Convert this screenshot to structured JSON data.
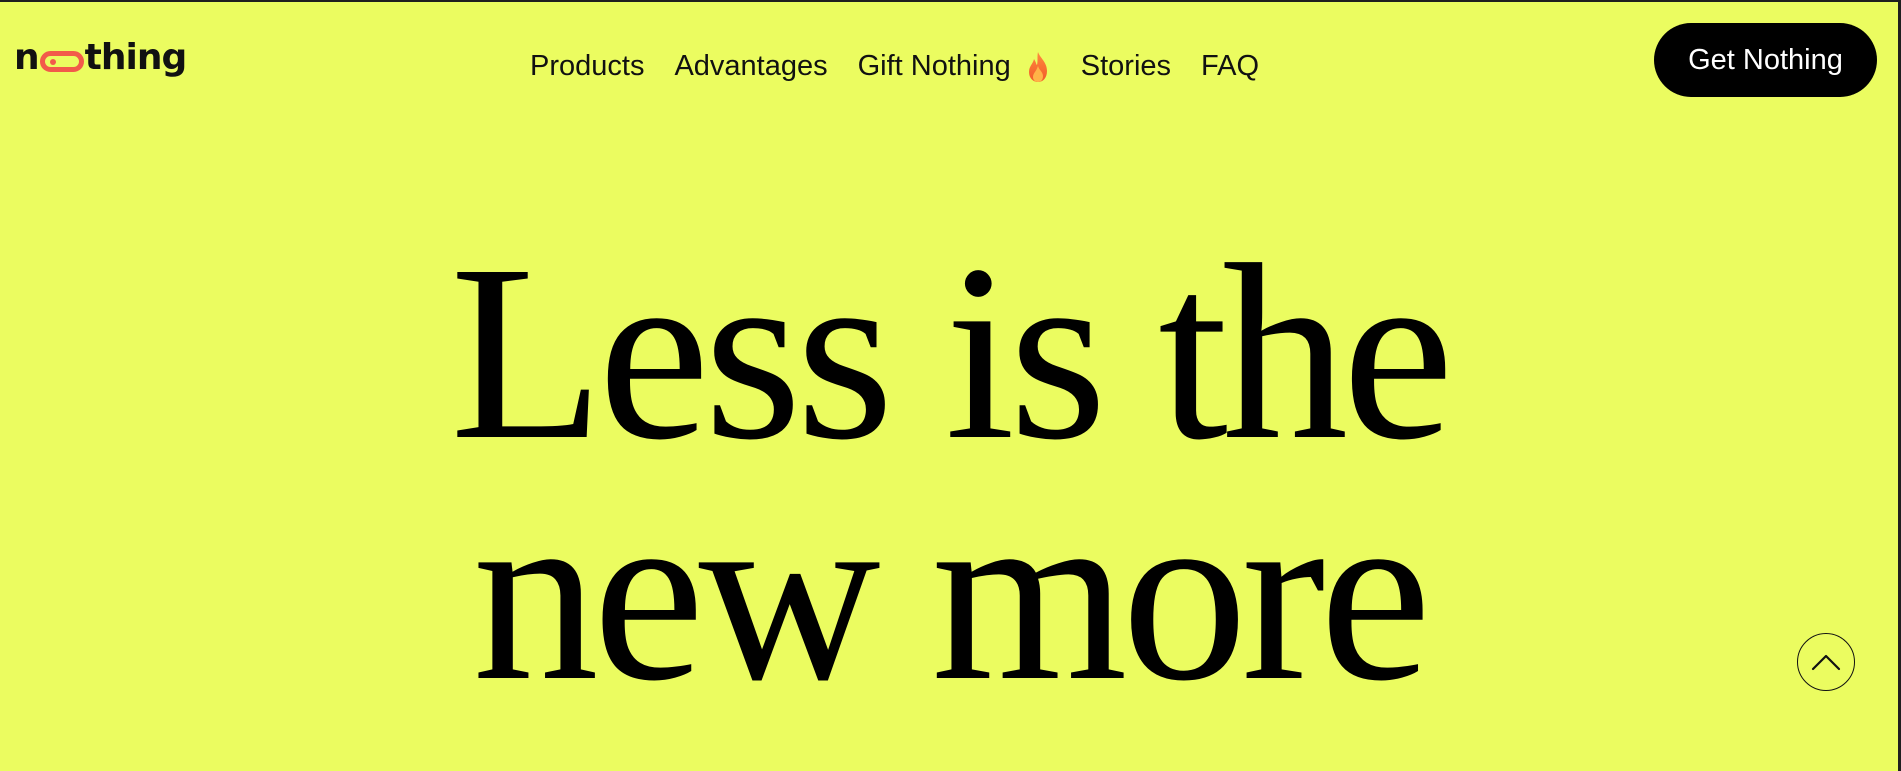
{
  "colors": {
    "background": "#ebfc60",
    "text": "#111111",
    "accent": "#f25a4a",
    "button_bg": "#000000",
    "button_text": "#ffffff"
  },
  "header": {
    "logo": {
      "text_before": "n",
      "text_after": "thing",
      "alt": "nothing"
    },
    "nav": [
      {
        "label": "Products"
      },
      {
        "label": "Advantages"
      },
      {
        "label": "Gift Nothing",
        "icon": "fire-emoji-icon"
      },
      {
        "label": "Stories"
      },
      {
        "label": "FAQ"
      }
    ],
    "cta_label": "Get Nothing"
  },
  "hero": {
    "line1": "Less is the",
    "line2": "new more"
  },
  "scroll_top": {
    "icon": "chevron-up-icon"
  }
}
